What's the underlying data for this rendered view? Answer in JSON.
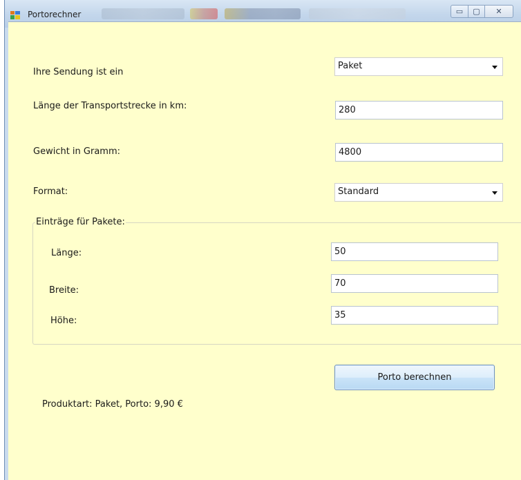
{
  "window": {
    "title": "Portorechner",
    "minimize_glyph": "▭",
    "maximize_glyph": "▢",
    "close_glyph": "✕"
  },
  "form": {
    "sendung_label": "Ihre Sendung ist ein",
    "sendung_value": "Paket",
    "laenge_strecke_label": "Länge der Transportstrecke in km:",
    "laenge_strecke_value": "280",
    "gewicht_label": "Gewicht in Gramm:",
    "gewicht_value": "4800",
    "format_label": "Format:",
    "format_value": "Standard"
  },
  "paket_group": {
    "legend": "Einträge für Pakete:",
    "laenge_label": "Länge:",
    "laenge_value": "50",
    "breite_label": "Breite:",
    "breite_value": "70",
    "hoehe_label": "Höhe:",
    "hoehe_value": "35"
  },
  "actions": {
    "calculate_label": "Porto berechnen"
  },
  "result": {
    "text": "Produktart: Paket, Porto: 9,90 €"
  },
  "colors": {
    "client_background": "#ffffcc",
    "titlebar": "#c3d6eb"
  }
}
